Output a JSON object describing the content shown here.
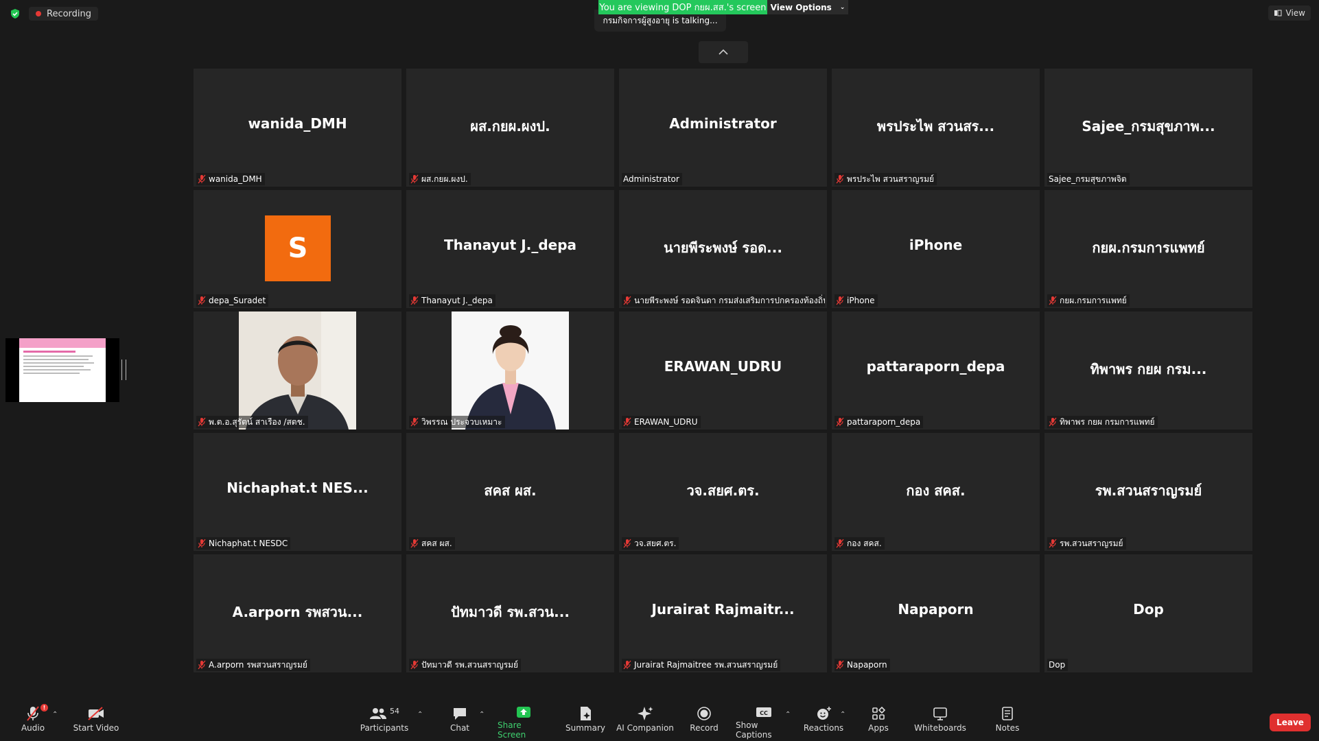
{
  "top": {
    "recording_label": "Recording",
    "viewing_banner": "You are viewing DOP กยผ.สส.'s screen",
    "talking_text": "กรมกิจการผู้สูงอายุ is talking...",
    "view_options_label": "View Options",
    "view_label": "View"
  },
  "tiles": [
    {
      "big": "wanida_DMH",
      "label": "wanida_DMH",
      "muted": true
    },
    {
      "big": "ผส.กยผ.ผงป.",
      "label": "ผส.กยผ.ผงป.",
      "muted": true
    },
    {
      "big": "Administrator",
      "label": "Administrator",
      "muted": false
    },
    {
      "big": "พรประไพ  สวนสร...",
      "label": "พรประไพ  สวนสราญรมย์",
      "muted": true
    },
    {
      "big": "Sajee_กรมสุขภาพ...",
      "label": "Sajee_กรมสุขภาพจิต",
      "muted": false
    },
    {
      "avatar": "S",
      "label": "depa_Suradet",
      "muted": true
    },
    {
      "big": "Thanayut J._depa",
      "label": "Thanayut J._depa",
      "muted": true
    },
    {
      "big": "นายพีระพงษ์ รอด...",
      "label": "นายพีระพงษ์ รอดจินดา กรมส่งเสริมการปกครองท้องถิ่น",
      "muted": true
    },
    {
      "big": "iPhone",
      "label": "iPhone",
      "muted": true
    },
    {
      "big": "กยผ.กรมการแพทย์",
      "label": "กยผ.กรมการแพทย์",
      "muted": true
    },
    {
      "photo": "man",
      "label": "พ.ต.อ.สุรัตน์ สาเรือง /สตช.",
      "muted": true
    },
    {
      "photo": "woman",
      "label": "วิพรรณ ประจวบเหมาะ",
      "muted": true
    },
    {
      "big": "ERAWAN_UDRU",
      "label": "ERAWAN_UDRU",
      "muted": true
    },
    {
      "big": "pattaraporn_depa",
      "label": "pattaraporn_depa",
      "muted": true
    },
    {
      "big": "ทิพาพร กยผ กรม...",
      "label": "ทิพาพร กยผ กรมการแพทย์",
      "muted": true
    },
    {
      "big": "Nichaphat.t  NES...",
      "label": "Nichaphat.t NESDC",
      "muted": true
    },
    {
      "big": "สคส ผส.",
      "label": "สคส ผส.",
      "muted": true
    },
    {
      "big": "วจ.สยศ.ตร.",
      "label": "วจ.สยศ.ตร.",
      "muted": true
    },
    {
      "big": "กอง สคส.",
      "label": "กอง สคส.",
      "muted": true
    },
    {
      "big": "รพ.สวนสราญรมย์",
      "label": "รพ.สวนสราญรมย์",
      "muted": true
    },
    {
      "big": "A.arporn รพสวน...",
      "label": "A.arporn รพสวนสราญรมย์",
      "muted": true
    },
    {
      "big": "ปัทมาวดี  รพ.สวน...",
      "label": "ปัทมาวดี  รพ.สวนสราญรมย์",
      "muted": true
    },
    {
      "big": "Jurairat  Rajmaitr...",
      "label": "Jurairat Rajmaitree รพ.สวนสราญรมย์",
      "muted": true
    },
    {
      "big": "Napaporn",
      "label": "Napaporn",
      "muted": true
    },
    {
      "big": "Dop",
      "label": "Dop",
      "muted": false
    }
  ],
  "toolbar": {
    "audio": "Audio",
    "start_video": "Start Video",
    "participants": "Participants",
    "participants_count": "54",
    "chat": "Chat",
    "share_screen": "Share Screen",
    "summary": "Summary",
    "ai_companion": "AI Companion",
    "record": "Record",
    "show_captions": "Show Captions",
    "reactions": "Reactions",
    "apps": "Apps",
    "whiteboards": "Whiteboards",
    "notes": "Notes",
    "leave": "Leave",
    "audio_badge": "!"
  },
  "colors": {
    "accent_green": "#24c85c",
    "leave_red": "#e0302f",
    "tile_bg": "#262626",
    "avatar_orange": "#f26b0f"
  }
}
